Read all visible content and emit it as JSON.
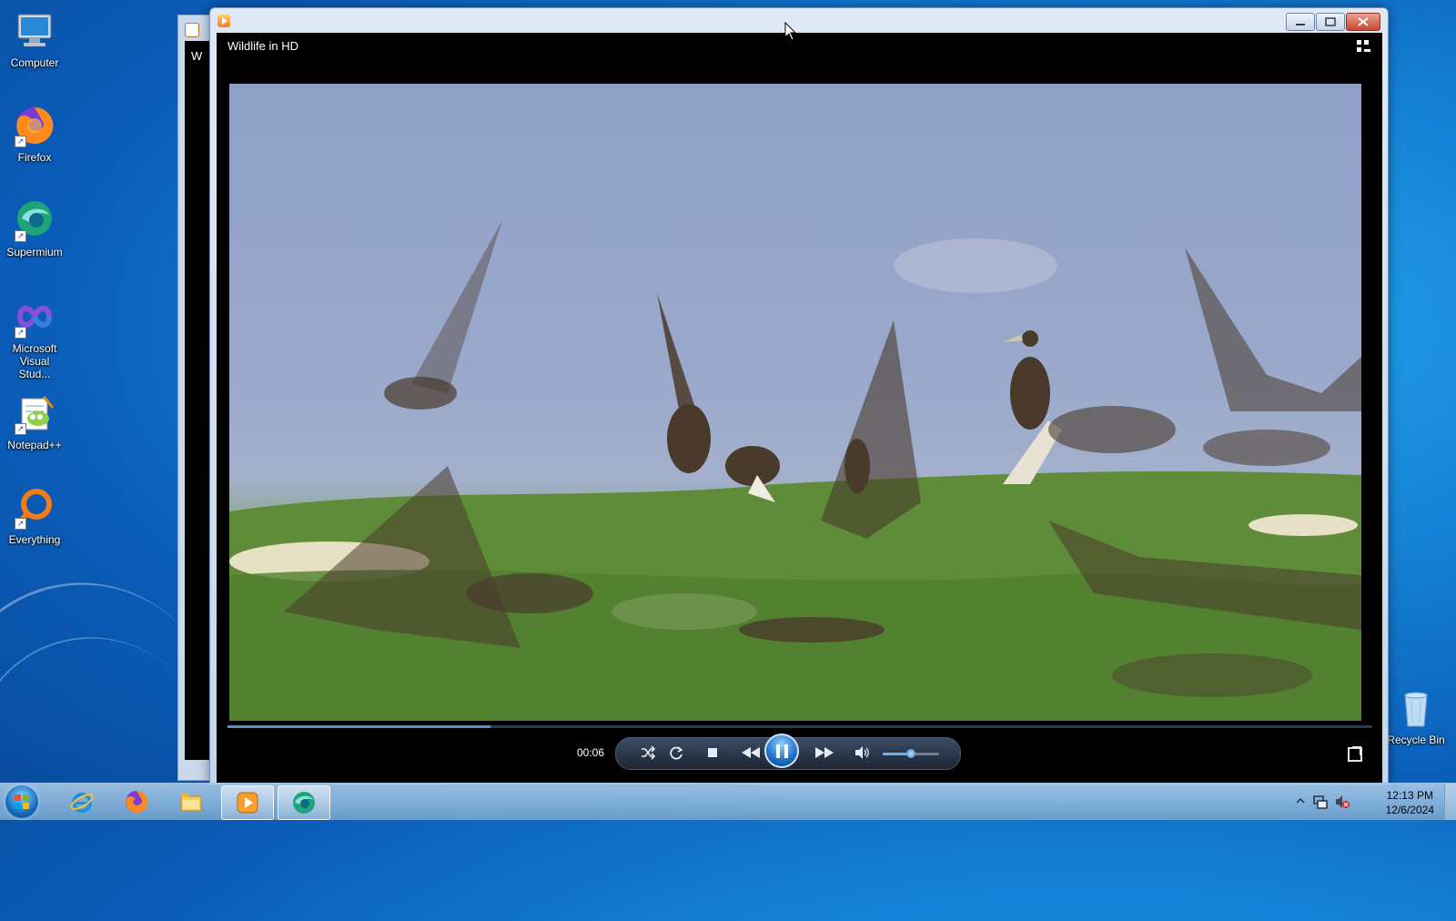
{
  "desktop": {
    "icons": [
      {
        "label": "Computer",
        "icon": "computer-icon"
      },
      {
        "label": "Firefox",
        "icon": "firefox-icon"
      },
      {
        "label": "Supermium",
        "icon": "supermium-icon"
      },
      {
        "label": "Microsoft Visual Stud...",
        "icon": "visual-studio-icon"
      },
      {
        "label": "Notepad++",
        "icon": "notepadpp-icon"
      },
      {
        "label": "Everything",
        "icon": "everything-icon"
      }
    ],
    "recycle_bin": {
      "label": "Recycle Bin",
      "icon": "recycle-bin-icon"
    }
  },
  "background_window": {
    "title_fragment": "W"
  },
  "player": {
    "title": "Wildlife in HD",
    "elapsed": "00:06",
    "progress": 0.23,
    "volume": 0.5,
    "state": "playing",
    "colors": {
      "accent": "#1d6fc8",
      "seek": "#5d8fd0"
    }
  },
  "taskbar": {
    "pinned": [
      "internet-explorer-icon",
      "firefox-icon",
      "file-explorer-icon",
      "media-player-icon",
      "supermium-icon"
    ],
    "active": "media-player-icon"
  },
  "clock": {
    "time": "12:13 PM",
    "date": "12/6/2024"
  }
}
